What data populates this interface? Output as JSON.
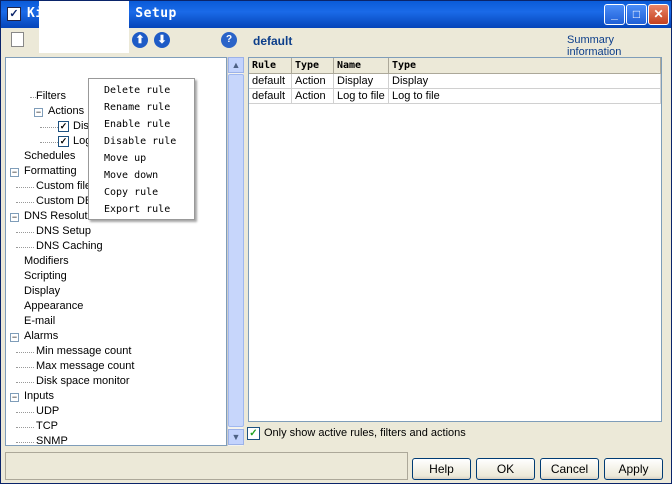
{
  "window": {
    "title": "Kiwi Syslog Daemon Setup",
    "title_visible": "Ki    og Daemon Setup",
    "title_icon": "check-icon",
    "minimize_glyph": "_",
    "maximize_glyph": "□",
    "close_glyph": "✕"
  },
  "toolbar": {
    "icons": [
      "new-icon",
      "save-icon",
      "move-up-icon",
      "move-down-icon",
      "help-icon"
    ],
    "up_glyph": "⬆",
    "down_glyph": "⬇",
    "help_glyph": "?",
    "crumb": "default",
    "summary_link": "Summary information"
  },
  "tree": {
    "items": [
      {
        "label": "Filters"
      },
      {
        "label": "Actions"
      },
      {
        "label": "Dis"
      },
      {
        "label": "Log"
      },
      {
        "label": "Schedules"
      },
      {
        "label": "Formatting"
      },
      {
        "label": "Custom file"
      },
      {
        "label": "Custom DB"
      },
      {
        "label": "DNS Resolution"
      },
      {
        "label": "DNS Setup"
      },
      {
        "label": "DNS Caching"
      },
      {
        "label": "Modifiers"
      },
      {
        "label": "Scripting"
      },
      {
        "label": "Display"
      },
      {
        "label": "Appearance"
      },
      {
        "label": "E-mail"
      },
      {
        "label": "Alarms"
      },
      {
        "label": "Min message count"
      },
      {
        "label": "Max message count"
      },
      {
        "label": "Disk space monitor"
      },
      {
        "label": "Inputs"
      },
      {
        "label": "UDP"
      },
      {
        "label": "TCP"
      },
      {
        "label": "SNMP"
      }
    ],
    "collapse_glyph": "−",
    "check_glyph": "✓"
  },
  "grid": {
    "columns": [
      "Rule",
      "Type",
      "Name",
      "Type"
    ],
    "rows": [
      [
        "default",
        "Action",
        "Display",
        "Display"
      ],
      [
        "default",
        "Action",
        "Log to file",
        "Log to file"
      ]
    ]
  },
  "filter_option": {
    "label": "Only show active rules, filters and actions",
    "checked": true,
    "check_glyph": "✓"
  },
  "context_menu": {
    "items": [
      "Delete rule",
      "Rename rule",
      "Enable rule",
      "Disable rule",
      "Move up",
      "Move down",
      "Copy rule",
      "Export rule"
    ]
  },
  "scrollbar": {
    "up_glyph": "▲",
    "down_glyph": "▼"
  },
  "buttons": {
    "help": "Help",
    "ok": "OK",
    "cancel": "Cancel",
    "apply": "Apply"
  },
  "colors": {
    "titlebar": "#0a5bd8",
    "accent_text": "#0c3e8a",
    "window_bg": "#ece9d8"
  }
}
